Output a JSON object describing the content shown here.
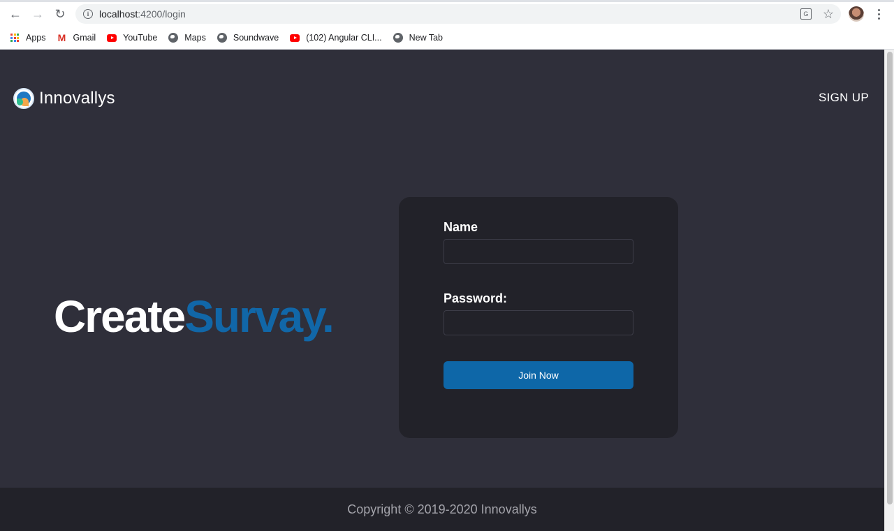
{
  "browser": {
    "url_host": "localhost",
    "url_path": ":4200/login",
    "bookmarks": [
      {
        "label": "Apps",
        "icon": "apps-grid-icon"
      },
      {
        "label": "Gmail",
        "icon": "gmail-icon"
      },
      {
        "label": "YouTube",
        "icon": "youtube-icon"
      },
      {
        "label": "Maps",
        "icon": "globe-icon"
      },
      {
        "label": "Soundwave",
        "icon": "globe-icon"
      },
      {
        "label": "(102) Angular CLI...",
        "icon": "youtube-icon"
      },
      {
        "label": "New Tab",
        "icon": "globe-icon"
      }
    ]
  },
  "header": {
    "brand_name": "Innovallys",
    "signup_label": "SIGN UP"
  },
  "hero": {
    "word_white": "Create",
    "word_blue": "Survay."
  },
  "form": {
    "name_label": "Name",
    "name_value": "",
    "password_label": "Password:",
    "password_value": "",
    "submit_label": "Join Now"
  },
  "footer": {
    "copyright": "Copyright © 2019-2020 Innovallys"
  },
  "colors": {
    "page_bg": "#2f2f3a",
    "card_bg": "#222229",
    "accent_blue": "#1167a8",
    "button_blue": "#0e67a8"
  }
}
